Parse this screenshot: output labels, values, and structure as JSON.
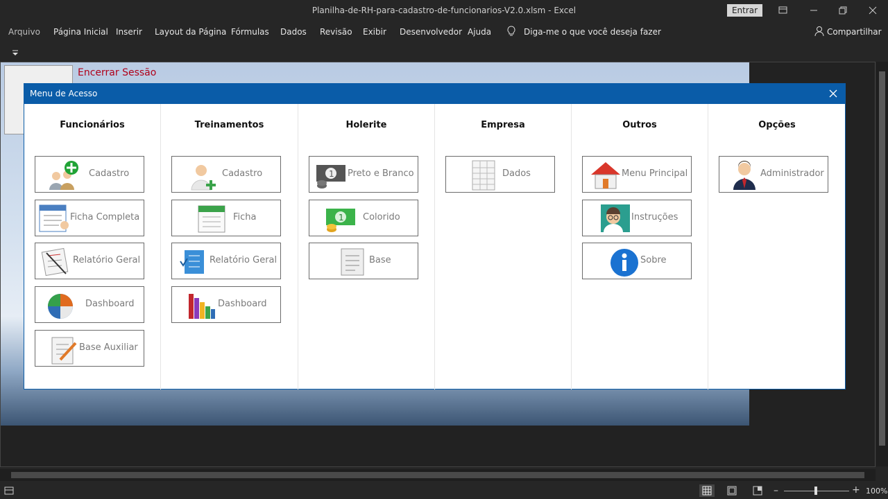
{
  "window": {
    "title": "Planilha-de-RH-para-cadastro-de-funcionarios-V2.0.xlsm  -  Excel",
    "signin_label": "Entrar"
  },
  "ribbon": {
    "tabs": [
      "Arquivo",
      "Página Inicial",
      "Inserir",
      "Layout da Página",
      "Fórmulas",
      "Dados",
      "Revisão",
      "Exibir",
      "Desenvolvedor",
      "Ajuda"
    ],
    "tellme": "Diga-me o que você deseja fazer",
    "share": "Compartilhar"
  },
  "sheet": {
    "logout_label": "Encerrar Sessão"
  },
  "dialog": {
    "title": "Menu de Acesso",
    "columns": [
      {
        "title": "Funcionários",
        "buttons": [
          {
            "label": "Cadastro",
            "icon": "add-people-icon"
          },
          {
            "label": "Ficha Completa",
            "icon": "form-icon"
          },
          {
            "label": "Relatório Geral",
            "icon": "report-icon"
          },
          {
            "label": "Dashboard",
            "icon": "pie-chart-icon"
          },
          {
            "label": "Base Auxiliar",
            "icon": "notepad-icon"
          }
        ]
      },
      {
        "title": "Treinamentos",
        "buttons": [
          {
            "label": "Cadastro",
            "icon": "add-user-icon"
          },
          {
            "label": "Ficha",
            "icon": "calendar-icon"
          },
          {
            "label": "Relatório Geral",
            "icon": "checklist-icon"
          },
          {
            "label": "Dashboard",
            "icon": "bar-chart-icon"
          }
        ]
      },
      {
        "title": "Holerite",
        "buttons": [
          {
            "label": "Preto e Branco",
            "icon": "money-bw-icon"
          },
          {
            "label": "Colorido",
            "icon": "money-color-icon"
          },
          {
            "label": "Base",
            "icon": "notes-icon"
          }
        ]
      },
      {
        "title": "Empresa",
        "buttons": [
          {
            "label": "Dados",
            "icon": "spreadsheet-icon"
          }
        ]
      },
      {
        "title": "Outros",
        "buttons": [
          {
            "label": "Menu Principal",
            "icon": "home-icon"
          },
          {
            "label": "Instruções",
            "icon": "teacher-icon"
          },
          {
            "label": "Sobre",
            "icon": "info-icon"
          }
        ]
      },
      {
        "title": "Opções",
        "buttons": [
          {
            "label": "Administrador",
            "icon": "admin-icon"
          }
        ]
      }
    ]
  },
  "statusbar": {
    "zoom": "100%"
  },
  "colors": {
    "dialog_header": "#0a5ca8",
    "logout_text": "#b0001a"
  }
}
